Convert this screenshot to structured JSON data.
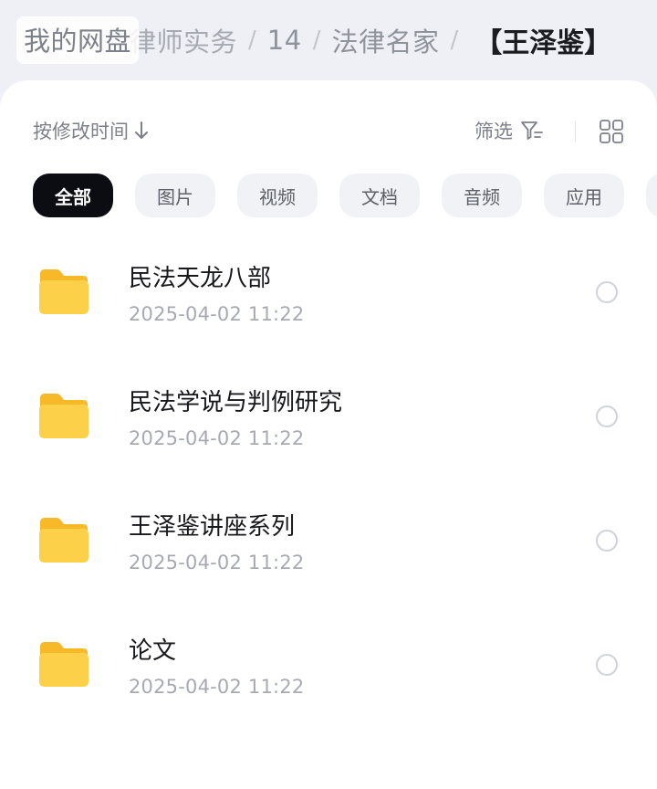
{
  "breadcrumb": {
    "root": "我的网盘",
    "partial": "律师实务",
    "sep": "/",
    "items": [
      "14",
      "法律名家"
    ],
    "current": "【王泽鉴】"
  },
  "toolbar": {
    "sort_label": "按修改时间",
    "sort_icon": "arrow-down-icon",
    "filter_label": "筛选",
    "filter_icon": "filter-icon",
    "view_icon": "grid-view-icon"
  },
  "tabs": [
    {
      "label": "全部",
      "active": true
    },
    {
      "label": "图片",
      "active": false
    },
    {
      "label": "视频",
      "active": false
    },
    {
      "label": "文档",
      "active": false
    },
    {
      "label": "音频",
      "active": false
    },
    {
      "label": "应用",
      "active": false
    }
  ],
  "files": [
    {
      "name": "民法天龙八部",
      "time": "2025-04-02  11:22",
      "icon": "folder-icon"
    },
    {
      "name": "民法学说与判例研究",
      "time": "2025-04-02  11:22",
      "icon": "folder-icon"
    },
    {
      "name": "王泽鉴讲座系列",
      "time": "2025-04-02  11:22",
      "icon": "folder-icon"
    },
    {
      "name": "论文",
      "time": "2025-04-02  11:22",
      "icon": "folder-icon"
    }
  ],
  "colors": {
    "folder": "#fcc93a",
    "active_tab": "#0c0d12",
    "background": "#f0f2f7"
  }
}
